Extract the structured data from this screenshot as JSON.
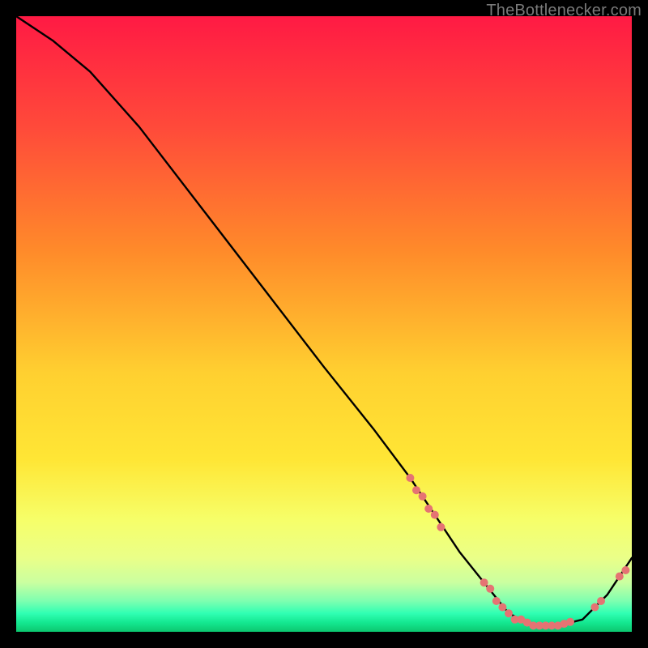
{
  "attribution": "TheBottlenecker.com",
  "colors": {
    "bg_black": "#000000",
    "grad_top": "#ff1a44",
    "grad_mid_up": "#ff8a2a",
    "grad_mid": "#ffe635",
    "grad_low1": "#f6ff6a",
    "grad_low2": "#c8ff8a",
    "grad_green_bright": "#1fff9c",
    "grad_green_deep": "#0cc76f",
    "curve": "#000000",
    "marker": "#e57373",
    "text": "#7a7a7a"
  },
  "chart_data": {
    "type": "line",
    "title": "",
    "xlabel": "",
    "ylabel": "",
    "xlim": [
      0,
      100
    ],
    "ylim": [
      0,
      100
    ],
    "series": [
      {
        "name": "curve",
        "x": [
          0,
          6,
          12,
          20,
          30,
          40,
          50,
          58,
          64,
          68,
          72,
          76,
          80,
          84,
          88,
          92,
          96,
          100
        ],
        "y": [
          100,
          96,
          91,
          82,
          69,
          56,
          43,
          33,
          25,
          19,
          13,
          8,
          3,
          1,
          1,
          2,
          6,
          12
        ]
      }
    ],
    "markers": [
      {
        "name": "cluster-descent",
        "points": [
          {
            "x": 64,
            "y": 25
          },
          {
            "x": 65,
            "y": 23
          },
          {
            "x": 66,
            "y": 22
          },
          {
            "x": 67,
            "y": 20
          },
          {
            "x": 68,
            "y": 19
          },
          {
            "x": 69,
            "y": 17
          }
        ]
      },
      {
        "name": "cluster-valley",
        "points": [
          {
            "x": 76,
            "y": 8
          },
          {
            "x": 77,
            "y": 7
          },
          {
            "x": 78,
            "y": 5
          },
          {
            "x": 79,
            "y": 4
          },
          {
            "x": 80,
            "y": 3
          },
          {
            "x": 81,
            "y": 2
          },
          {
            "x": 82,
            "y": 2
          },
          {
            "x": 83,
            "y": 1.5
          },
          {
            "x": 84,
            "y": 1
          },
          {
            "x": 85,
            "y": 1
          },
          {
            "x": 86,
            "y": 1
          },
          {
            "x": 87,
            "y": 1
          },
          {
            "x": 88,
            "y": 1
          },
          {
            "x": 89,
            "y": 1.3
          },
          {
            "x": 90,
            "y": 1.6
          }
        ]
      },
      {
        "name": "cluster-upturn",
        "points": [
          {
            "x": 94,
            "y": 4
          },
          {
            "x": 95,
            "y": 5
          },
          {
            "x": 98,
            "y": 9
          },
          {
            "x": 99,
            "y": 10
          }
        ]
      }
    ]
  }
}
